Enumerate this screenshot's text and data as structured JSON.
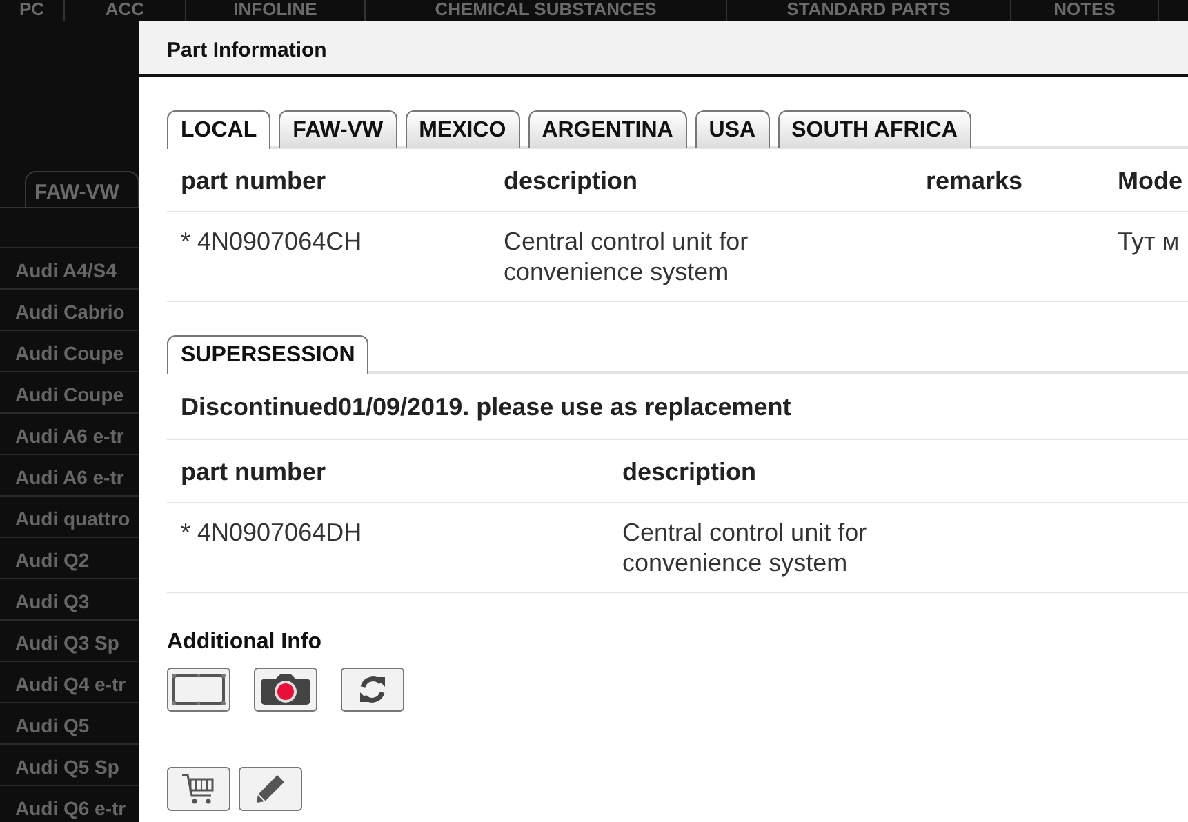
{
  "background": {
    "top_tabs": [
      {
        "label": "PC"
      },
      {
        "label": "ACC"
      },
      {
        "label": "INFOLINE"
      },
      {
        "label": "CHEMICAL SUBSTANCES"
      },
      {
        "label": "STANDARD PARTS"
      },
      {
        "label": "NOTES"
      }
    ],
    "sub_tabs": [
      {
        "label": "FAW-VW"
      }
    ],
    "model_list": [
      "Audi A4/S4",
      "Audi Cabrio",
      "Audi Coupe",
      "Audi Coupe",
      "Audi A6 e-tr",
      "Audi A6 e-tr",
      "Audi quattro",
      "Audi Q2",
      "Audi Q3",
      "Audi Q3 Sp",
      "Audi Q4 e-tr",
      "Audi Q5",
      "Audi Q5 Sp",
      "Audi Q6 e-tr"
    ]
  },
  "dialog": {
    "title": "Part Information",
    "region_tabs": [
      {
        "label": "LOCAL",
        "selected": true
      },
      {
        "label": "FAW-VW",
        "selected": false
      },
      {
        "label": "MEXICO",
        "selected": false
      },
      {
        "label": "ARGENTINA",
        "selected": false
      },
      {
        "label": "USA",
        "selected": false
      },
      {
        "label": "SOUTH AFRICA",
        "selected": false
      }
    ],
    "parts_table": {
      "columns": [
        "part number",
        "description",
        "remarks",
        "Mode"
      ],
      "rows": [
        [
          "* 4N0907064CH",
          "Central control unit for convenience system",
          "",
          "Тут м"
        ]
      ]
    },
    "supersession_tab": {
      "label": "SUPERSESSION",
      "selected": true
    },
    "supersession_message": "Discontinued01/09/2019. please use as replacement",
    "replacement_table": {
      "columns": [
        "part number",
        "description"
      ],
      "rows": [
        [
          "* 4N0907064DH",
          "Central control unit for convenience system"
        ]
      ]
    },
    "additional_info": {
      "label": "Additional Info",
      "buttons": [
        {
          "kind": "frame"
        },
        {
          "kind": "camera"
        },
        {
          "kind": "refresh"
        }
      ]
    },
    "actions": [
      {
        "kind": "cart"
      },
      {
        "kind": "pencil"
      }
    ]
  }
}
